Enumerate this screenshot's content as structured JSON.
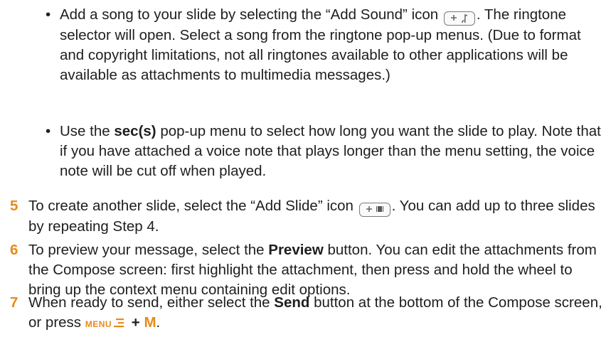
{
  "bullets": [
    {
      "marker": "•",
      "before_icon": "Add a song to your slide by selecting the “Add Sound” icon ",
      "icon": {
        "name": "add-sound-icon",
        "label": "+ ♪"
      },
      "after_icon": ". The ringtone selector will open. Select a song from the ringtone pop-up menus. (Due to format and copyright limitations, not all ringtones available to other applications will be available as attachments to multimedia messages.)"
    },
    {
      "marker": "•",
      "before_bold": "Use the ",
      "bold": "sec(s)",
      "after_bold": " pop-up menu to select how long you want the slide to play. Note that if you have attached a voice note that plays longer than the menu setting, the voice note will be cut off when played."
    }
  ],
  "steps": [
    {
      "number": "5",
      "before_icon": "To create another slide, select the “Add Slide” icon ",
      "icon": {
        "name": "add-slide-icon",
        "label": "+ ▮▮"
      },
      "after_icon": ". You can add up to three slides by repeating Step 4."
    },
    {
      "number": "6",
      "before_bold": "To preview your message, select the ",
      "bold": "Preview",
      "after_bold": " button. You can edit the attachments from the Compose screen: first highlight the attachment, then press and hold the wheel to bring up the context menu containing edit options."
    },
    {
      "number": "7",
      "before_bold": "When ready to send, either select the ",
      "bold": "Send",
      "after_bold": " button at the bottom of the Compose screen, or press ",
      "menu_key": "MENU",
      "plus": " + ",
      "key": "M",
      "end": "."
    }
  ],
  "colors": {
    "accent": "#e88a1a",
    "text": "#1e1e1e"
  }
}
